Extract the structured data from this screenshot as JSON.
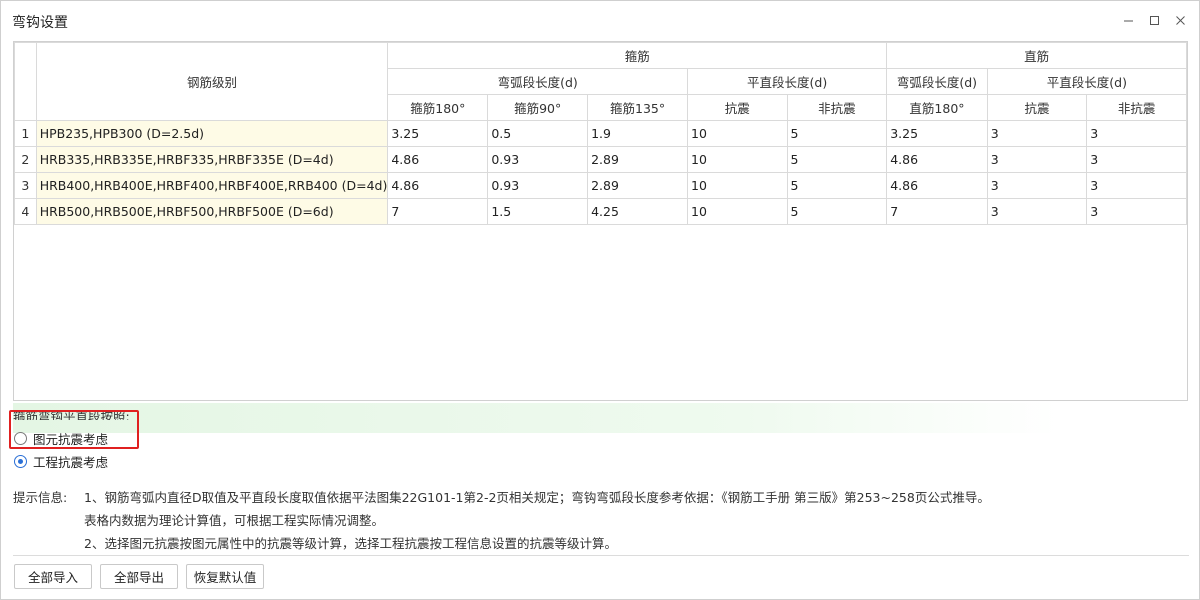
{
  "window": {
    "title": "弯钩设置"
  },
  "table": {
    "header": {
      "grade": "钢筋级别",
      "stirrup": "箍筋",
      "straight": "直筋",
      "arc_len": "弯弧段长度(d)",
      "flat_len": "平直段长度(d)",
      "straight_arc_len": "弯弧段长度(d)",
      "straight_flat_len": "平直段长度(d)",
      "cols": [
        "箍筋180°",
        "箍筋90°",
        "箍筋135°",
        "抗震",
        "非抗震",
        "直筋180°",
        "抗震",
        "非抗震"
      ]
    },
    "rows": [
      {
        "num": "1",
        "grade": "HPB235,HPB300 (D=2.5d)",
        "cells": [
          "3.25",
          "0.5",
          "1.9",
          "10",
          "5",
          "3.25",
          "3",
          "3"
        ]
      },
      {
        "num": "2",
        "grade": "HRB335,HRB335E,HRBF335,HRBF335E (D=4d)",
        "cells": [
          "4.86",
          "0.93",
          "2.89",
          "10",
          "5",
          "4.86",
          "3",
          "3"
        ]
      },
      {
        "num": "3",
        "grade": "HRB400,HRB400E,HRBF400,HRBF400E,RRB400 (D=4d)",
        "cells": [
          "4.86",
          "0.93",
          "2.89",
          "10",
          "5",
          "4.86",
          "3",
          "3"
        ]
      },
      {
        "num": "4",
        "grade": "HRB500,HRB500E,HRBF500,HRBF500E (D=6d)",
        "cells": [
          "7",
          "1.5",
          "4.25",
          "10",
          "5",
          "7",
          "3",
          "3"
        ]
      }
    ]
  },
  "options": {
    "label": "箍筋弯钩平直段按照:",
    "radio1": "图元抗震考虑",
    "radio2": "工程抗震考虑",
    "selected": "radio2"
  },
  "hint": {
    "label": "提示信息:",
    "line1": "1、钢筋弯弧内直径D取值及平直段长度取值依据平法图集22G101-1第2-2页相关规定；弯钩弯弧段长度参考依据：《钢筋工手册 第三版》第253~258页公式推导。",
    "line2": "表格内数据为理论计算值，可根据工程实际情况调整。",
    "line3": "2、选择图元抗震按图元属性中的抗震等级计算，选择工程抗震按工程信息设置的抗震等级计算。"
  },
  "buttons": {
    "import_all": "全部导入",
    "export_all": "全部导出",
    "restore_default": "恢复默认值"
  },
  "colors": {
    "highlight_border": "#e02020",
    "grade_cell_bg": "#fefbe6",
    "radio_accent": "#2a6fd6",
    "option_band": "#e4f6e4"
  }
}
